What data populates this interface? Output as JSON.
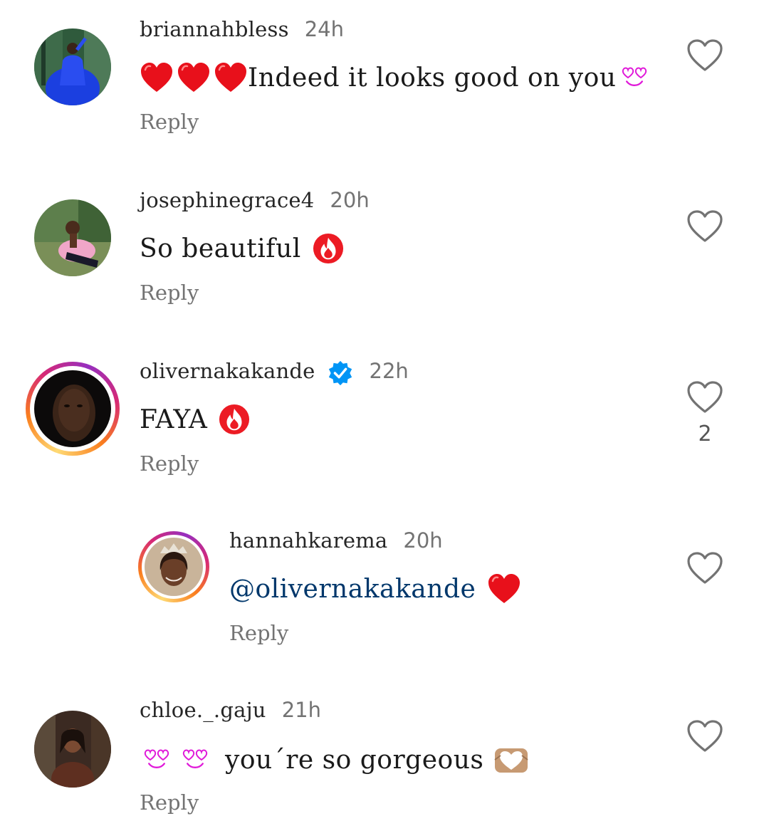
{
  "comments": [
    {
      "username": "briannahbless",
      "time": "24h",
      "text": "Indeed it looks good on you",
      "reply_label": "Reply",
      "emojis": [
        "red-heart",
        "red-heart",
        "red-heart",
        "heart-eyes-pink"
      ]
    },
    {
      "username": "josephinegrace4",
      "time": "20h",
      "text": "So beautiful",
      "reply_label": "Reply",
      "emojis": [
        "fire"
      ]
    },
    {
      "username": "olivernakakande",
      "time": "22h",
      "verified": true,
      "text": "FAYA",
      "reply_label": "Reply",
      "like_count": "2",
      "emojis": [
        "fire"
      ]
    },
    {
      "username": "hannahkarema",
      "time": "20h",
      "mention": "@olivernakakande",
      "reply_label": "Reply",
      "is_reply": true,
      "emojis": [
        "red-heart"
      ]
    },
    {
      "username": "chloe._.gaju",
      "time": "21h",
      "text": "you´re so gorgeous",
      "reply_label": "Reply",
      "emojis": [
        "heart-eyes-pink",
        "heart-eyes-pink",
        "heart-hands"
      ]
    }
  ],
  "colors": {
    "username": "#262626",
    "secondary_text": "#737373",
    "mention": "#00376b",
    "verified_badge": "#0095f6",
    "story_ring": [
      "#feda75",
      "#fa7e1e",
      "#d62976",
      "#962fbf"
    ]
  }
}
